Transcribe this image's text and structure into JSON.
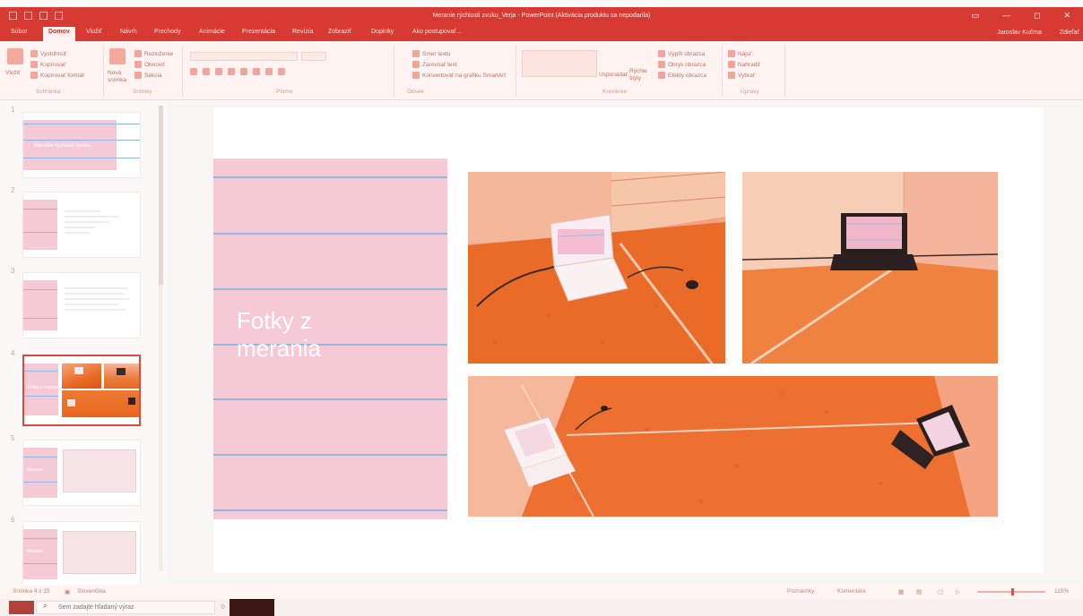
{
  "app": {
    "title": "Meranie rýchlosti zvuku_Verja - PowerPoint (Aktivácia produktu sa nepodarila)",
    "accent": "#d63a32",
    "user": "Jaroslav Kučma",
    "share_label": "Zdieľať"
  },
  "tabs": [
    {
      "label": "Súbor"
    },
    {
      "label": "Domov",
      "active": true
    },
    {
      "label": "Vložiť"
    },
    {
      "label": "Návrh"
    },
    {
      "label": "Prechody"
    },
    {
      "label": "Animácie"
    },
    {
      "label": "Prezentácia"
    },
    {
      "label": "Revízia"
    },
    {
      "label": "Zobraziť"
    },
    {
      "label": "Doplnky"
    },
    {
      "label": "Ako postupovať..."
    }
  ],
  "ribbon": {
    "clipboard": {
      "paste": "Vložiť",
      "cut": "Vystrihnúť",
      "copy": "Kopírovať",
      "format_painter": "Kopírovať formát",
      "group_label": "Schránka"
    },
    "slides": {
      "new_slide": "Nová snímka",
      "layout": "Rozloženie",
      "reset": "Obnoviť",
      "section": "Sekcia",
      "group_label": "Snímky"
    },
    "font": {
      "group_label": "Písmo"
    },
    "paragraph": {
      "text_direction": "Smer textu",
      "align_text": "Zarovnať text",
      "smartart": "Konvertovať na grafiku SmartArt",
      "group_label": "Odsek"
    },
    "drawing": {
      "arrange": "Usporiadať",
      "quick_styles": "Rýchle štýly",
      "shape_fill": "Výplň obrazca",
      "shape_outline": "Obrys obrazca",
      "shape_effects": "Efekty obrazca",
      "group_label": "Kreslenie"
    },
    "editing": {
      "find": "Nájsť",
      "replace": "Nahradiť",
      "select": "Vybrať",
      "group_label": "Úpravy"
    }
  },
  "thumbnails": [
    {
      "number": "1",
      "caption": "Meranie rýchlosti zvuku"
    },
    {
      "number": "2",
      "caption": ""
    },
    {
      "number": "3",
      "caption": ""
    },
    {
      "number": "4",
      "caption": "Fotky z merania",
      "selected": true
    },
    {
      "number": "5",
      "caption": "Meranie"
    },
    {
      "number": "6",
      "caption": "Meranie"
    }
  ],
  "slide": {
    "title": "Fotky z\nmerania"
  },
  "statusbar": {
    "slide_info": "Snímka 4 z 15",
    "language": "Slovenčina",
    "notes": "Poznámky",
    "comments": "Komentáre",
    "zoom": "115%"
  },
  "taskbar": {
    "search_placeholder": "Sem zadajte hľadaný výraz"
  }
}
